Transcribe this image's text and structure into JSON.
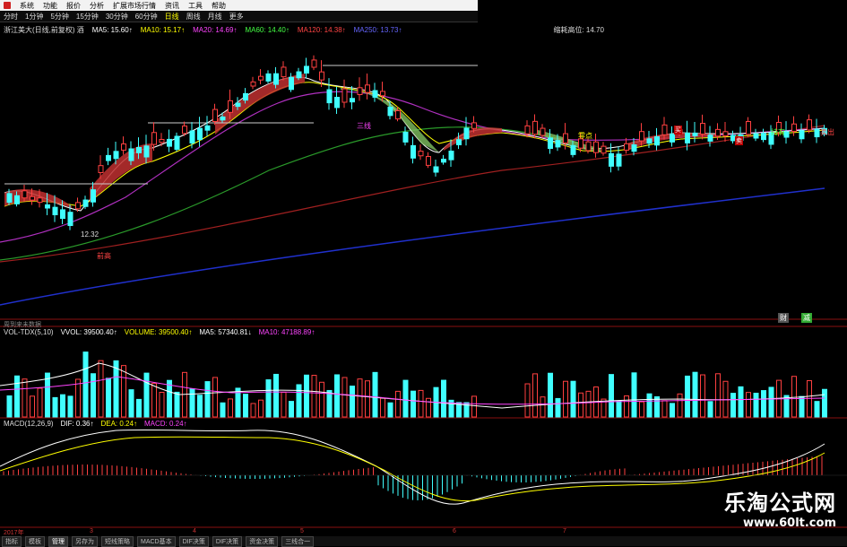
{
  "menu": {
    "items": [
      "系统",
      "功能",
      "报价",
      "分析",
      "扩展市场行情",
      "资讯",
      "工具",
      "帮助"
    ]
  },
  "periods": {
    "items": [
      "分时",
      "1分钟",
      "5分钟",
      "15分钟",
      "30分钟",
      "60分钟",
      "日线",
      "周线",
      "月线",
      "更多"
    ]
  },
  "info": {
    "stock": "浙江美大(日线,前复权) 酒",
    "ma5": "MA5: 15.60↑",
    "ma10": "MA10: 15.17↑",
    "ma20": "MA20: 14.69↑",
    "ma60": "MA60: 14.40↑",
    "ma120": "MA120: 14.38↑",
    "ma250": "MA250: 13.73↑",
    "extra": "缩耗高位: 14.70"
  },
  "annotations": {
    "low_price": "12.32",
    "label_support": "三线",
    "label_high": "前高",
    "tag_red1": "买",
    "tag_red2": "卖",
    "tag_right": "卖出",
    "tag_hold": "持有",
    "tag_zero": "零点",
    "tag_finance": "财",
    "tag_news": "减"
  },
  "panels": {
    "indicator_hint": "周到来未数据",
    "vol_name": "VOL-TDX(5,10)",
    "vvol": "VVOL: 39500.40↑",
    "volume": "VOLUME: 39500.40↑",
    "vol_ma5": "MA5: 57340.81↓",
    "vol_ma10": "MA10: 47188.89↑",
    "macd_name": "MACD(12,26,9)",
    "dif": "DIF: 0.36↑",
    "dea": "DEA: 0.24↑",
    "macd": "MACD: 0.24↑"
  },
  "xaxis": {
    "labels": [
      "2017年",
      "3",
      "4",
      "5",
      "6",
      "7"
    ]
  },
  "bottom_tabs": [
    "指标",
    "模板",
    "管理",
    "另存为",
    "短线策略",
    "MACD基本",
    "DIF决策",
    "DIF决策",
    "资金决策",
    "三线合一"
  ],
  "watermark": {
    "cn": "乐淘公式网",
    "url": "www.60lt.com"
  },
  "colors": {
    "up": "#ff4040",
    "down": "#40ffff",
    "ma5": "#ffffff",
    "ma10": "#ffff00",
    "ma20": "#ff40ff",
    "ma60": "#40ff40",
    "ma250": "#2020cc"
  }
}
